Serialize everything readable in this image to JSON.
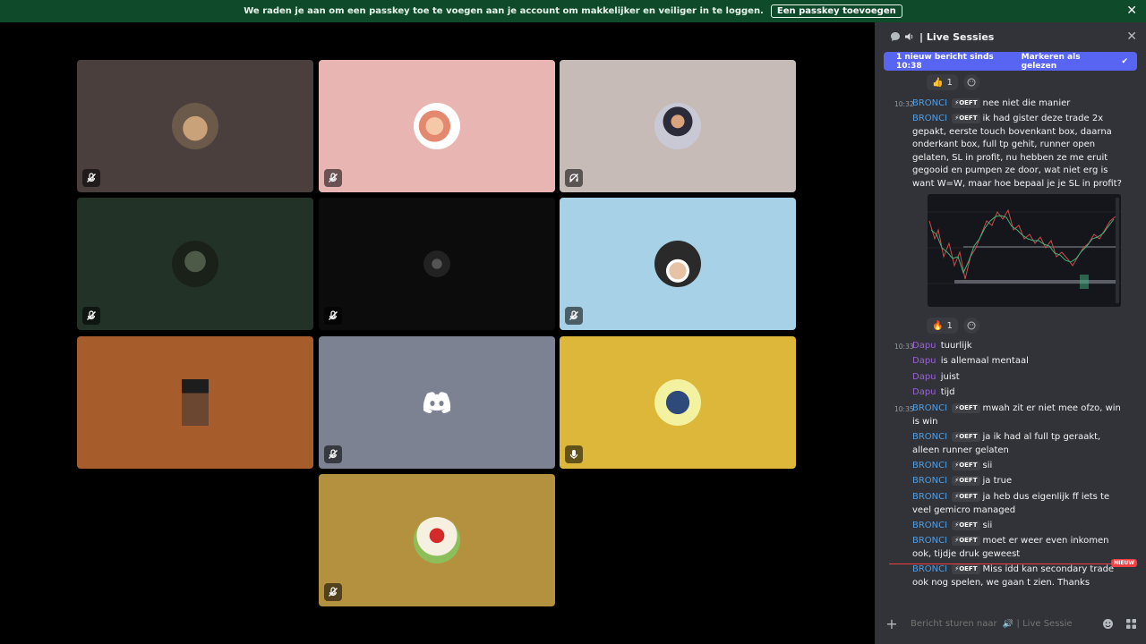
{
  "banner": {
    "text": "We raden je aan om een passkey toe te voegen aan je account om makkelijker en veiliger in te loggen.",
    "button": "Een passkey toevoegen"
  },
  "tiles": [
    {
      "color": "#4a3f3d"
    },
    {
      "color": "#e9b5b3"
    },
    {
      "color": "#c7bbb7"
    },
    {
      "color": "#223227"
    },
    {
      "color": "#0c0c0c"
    },
    {
      "color": "#a7d1e6"
    },
    {
      "color": "#a75d2b"
    },
    {
      "color": "#7c8291"
    },
    {
      "color": "#dcb73a"
    },
    {
      "color": "#b4913f"
    }
  ],
  "panel": {
    "title": "| Live Sessies",
    "new_bar": "1 nieuw bericht sinds 10:38",
    "mark_read": "Markeren als gelezen",
    "composer_placeholder": "Bericht sturen naar  🔊 | Live Sessies",
    "nieuw": "NIEUW"
  },
  "reactions": [
    {
      "emoji": "👍",
      "count": "1"
    },
    {
      "emoji": "🔥",
      "count": "1"
    }
  ],
  "messages": [
    {
      "time": "10:32",
      "author": "BRONCI",
      "tag": "⚡OEFT",
      "text": "nee niet die manier"
    },
    {
      "time": "",
      "author": "BRONCI",
      "tag": "⚡OEFT",
      "text": "ik had gister deze trade 2x gepakt, eerste touch bovenkant box, daarna onderkant box, full tp gehit, runner open gelaten, SL in profit, nu hebben ze me eruit gegooid en pumpen ze door, wat niet erg is want W=W, maar hoe bepaal je je SL in profit?"
    },
    {
      "time": "10:33",
      "author": "Dapu",
      "tag": "",
      "text": "tuurlijk"
    },
    {
      "time": "",
      "author": "Dapu",
      "tag": "",
      "text": "is allemaal mentaal"
    },
    {
      "time": "",
      "author": "Dapu",
      "tag": "",
      "text": "juist"
    },
    {
      "time": "",
      "author": "Dapu",
      "tag": "",
      "text": "tijd"
    },
    {
      "time": "10:35",
      "author": "BRONCI",
      "tag": "⚡OEFT",
      "text": "mwah zit er niet mee ofzo, win is win"
    },
    {
      "time": "",
      "author": "BRONCI",
      "tag": "⚡OEFT",
      "text": "ja ik had al full tp geraakt, alleen runner gelaten"
    },
    {
      "time": "",
      "author": "BRONCI",
      "tag": "⚡OEFT",
      "text": "sii"
    },
    {
      "time": "",
      "author": "BRONCI",
      "tag": "⚡OEFT",
      "text": "ja true"
    },
    {
      "time": "",
      "author": "BRONCI",
      "tag": "⚡OEFT",
      "text": "ja heb dus eigenlijk ff iets te veel gemicro managed"
    },
    {
      "time": "",
      "author": "BRONCI",
      "tag": "⚡OEFT",
      "text": "sii"
    },
    {
      "time": "",
      "author": "BRONCI",
      "tag": "⚡OEFT",
      "text": "moet er weer even inkomen ook, tijdje druk geweest"
    },
    {
      "time": "",
      "author": "BRONCI",
      "tag": "⚡OEFT",
      "text": "Miss idd kan secondary trade ook nog spelen, we gaan t zien. Thanks"
    }
  ]
}
